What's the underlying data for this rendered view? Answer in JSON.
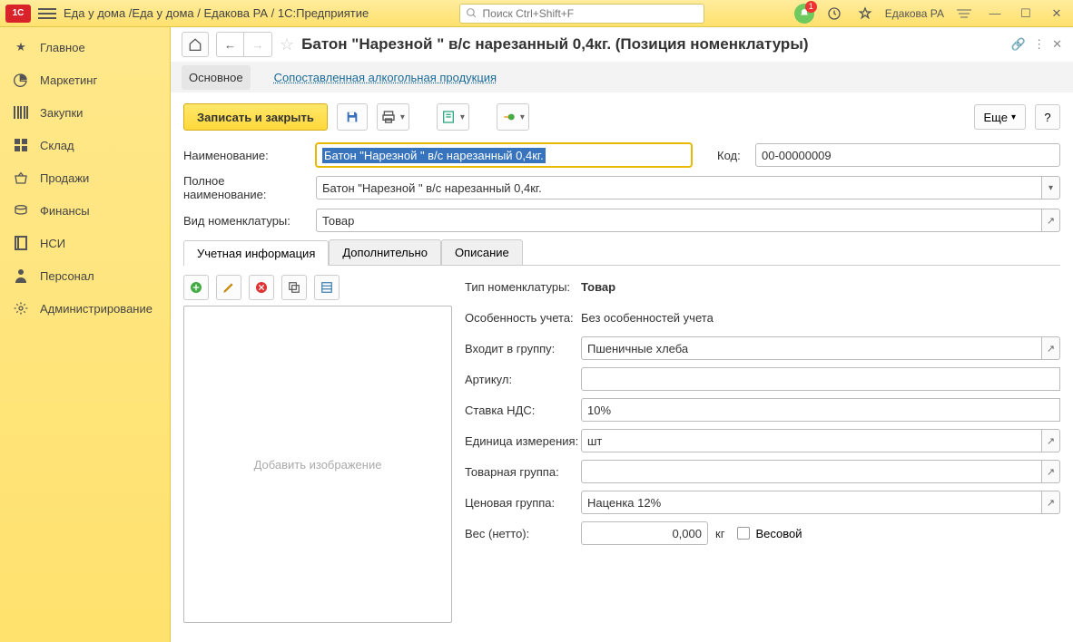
{
  "titlebar": {
    "app_title": "Еда у дома /Еда у дома / Едакова РА / 1С:Предприятие",
    "search_placeholder": "Поиск Ctrl+Shift+F",
    "bell_count": "1",
    "username": "Едакова РА"
  },
  "sidebar": {
    "items": [
      {
        "label": "Главное"
      },
      {
        "label": "Маркетинг"
      },
      {
        "label": "Закупки"
      },
      {
        "label": "Склад"
      },
      {
        "label": "Продажи"
      },
      {
        "label": "Финансы"
      },
      {
        "label": "НСИ"
      },
      {
        "label": "Персонал"
      },
      {
        "label": "Администрирование"
      }
    ]
  },
  "header": {
    "title": "Батон \"Нарезной \"  в/с нарезанный 0,4кг. (Позиция номенклатуры)"
  },
  "subtabs": {
    "main": "Основное",
    "alcohol": "Сопоставленная алкогольная продукция"
  },
  "toolbar": {
    "save_close": "Записать и закрыть",
    "more": "Еще"
  },
  "form": {
    "name_label": "Наименование:",
    "name_value": "Батон \"Нарезной \"  в/с нарезанный 0,4кг.",
    "code_label": "Код:",
    "code_value": "00-00000009",
    "fullname_label": "Полное наименование:",
    "fullname_value": "Батон \"Нарезной \"  в/с нарезанный 0,4кг.",
    "kind_label": "Вид номенклатуры:",
    "kind_value": "Товар"
  },
  "tabs": {
    "t1": "Учетная информация",
    "t2": "Дополнительно",
    "t3": "Описание"
  },
  "image_placeholder": "Добавить изображение",
  "props": {
    "type_label": "Тип номенклатуры:",
    "type_value": "Товар",
    "feat_label": "Особенность учета:",
    "feat_value": "Без особенностей учета",
    "group_label": "Входит в группу:",
    "group_value": "Пшеничные хлеба",
    "article_label": "Артикул:",
    "article_value": "",
    "vat_label": "Ставка НДС:",
    "vat_value": "10%",
    "unit_label": "Единица измерения:",
    "unit_value": "шт",
    "goods_group_label": "Товарная группа:",
    "goods_group_value": "",
    "price_group_label": "Ценовая группа:",
    "price_group_value": "Наценка 12%",
    "weight_label": "Вес (нетто):",
    "weight_value": "0,000",
    "weight_unit": "кг",
    "weighted_label": "Весовой"
  }
}
